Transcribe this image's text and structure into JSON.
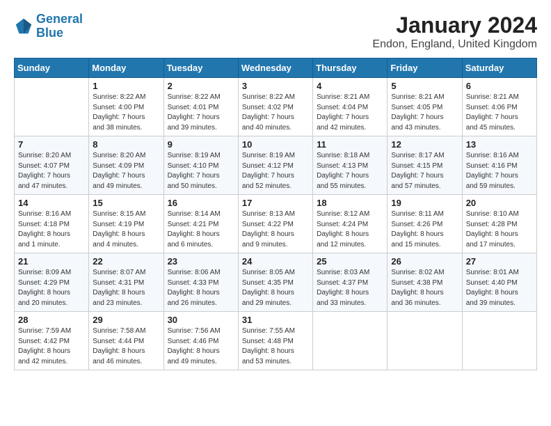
{
  "header": {
    "logo_line1": "General",
    "logo_line2": "Blue",
    "main_title": "January 2024",
    "subtitle": "Endon, England, United Kingdom"
  },
  "days_of_week": [
    "Sunday",
    "Monday",
    "Tuesday",
    "Wednesday",
    "Thursday",
    "Friday",
    "Saturday"
  ],
  "weeks": [
    [
      {
        "day": "",
        "info": ""
      },
      {
        "day": "1",
        "info": "Sunrise: 8:22 AM\nSunset: 4:00 PM\nDaylight: 7 hours\nand 38 minutes."
      },
      {
        "day": "2",
        "info": "Sunrise: 8:22 AM\nSunset: 4:01 PM\nDaylight: 7 hours\nand 39 minutes."
      },
      {
        "day": "3",
        "info": "Sunrise: 8:22 AM\nSunset: 4:02 PM\nDaylight: 7 hours\nand 40 minutes."
      },
      {
        "day": "4",
        "info": "Sunrise: 8:21 AM\nSunset: 4:04 PM\nDaylight: 7 hours\nand 42 minutes."
      },
      {
        "day": "5",
        "info": "Sunrise: 8:21 AM\nSunset: 4:05 PM\nDaylight: 7 hours\nand 43 minutes."
      },
      {
        "day": "6",
        "info": "Sunrise: 8:21 AM\nSunset: 4:06 PM\nDaylight: 7 hours\nand 45 minutes."
      }
    ],
    [
      {
        "day": "7",
        "info": "Sunrise: 8:20 AM\nSunset: 4:07 PM\nDaylight: 7 hours\nand 47 minutes."
      },
      {
        "day": "8",
        "info": "Sunrise: 8:20 AM\nSunset: 4:09 PM\nDaylight: 7 hours\nand 49 minutes."
      },
      {
        "day": "9",
        "info": "Sunrise: 8:19 AM\nSunset: 4:10 PM\nDaylight: 7 hours\nand 50 minutes."
      },
      {
        "day": "10",
        "info": "Sunrise: 8:19 AM\nSunset: 4:12 PM\nDaylight: 7 hours\nand 52 minutes."
      },
      {
        "day": "11",
        "info": "Sunrise: 8:18 AM\nSunset: 4:13 PM\nDaylight: 7 hours\nand 55 minutes."
      },
      {
        "day": "12",
        "info": "Sunrise: 8:17 AM\nSunset: 4:15 PM\nDaylight: 7 hours\nand 57 minutes."
      },
      {
        "day": "13",
        "info": "Sunrise: 8:16 AM\nSunset: 4:16 PM\nDaylight: 7 hours\nand 59 minutes."
      }
    ],
    [
      {
        "day": "14",
        "info": "Sunrise: 8:16 AM\nSunset: 4:18 PM\nDaylight: 8 hours\nand 1 minute."
      },
      {
        "day": "15",
        "info": "Sunrise: 8:15 AM\nSunset: 4:19 PM\nDaylight: 8 hours\nand 4 minutes."
      },
      {
        "day": "16",
        "info": "Sunrise: 8:14 AM\nSunset: 4:21 PM\nDaylight: 8 hours\nand 6 minutes."
      },
      {
        "day": "17",
        "info": "Sunrise: 8:13 AM\nSunset: 4:22 PM\nDaylight: 8 hours\nand 9 minutes."
      },
      {
        "day": "18",
        "info": "Sunrise: 8:12 AM\nSunset: 4:24 PM\nDaylight: 8 hours\nand 12 minutes."
      },
      {
        "day": "19",
        "info": "Sunrise: 8:11 AM\nSunset: 4:26 PM\nDaylight: 8 hours\nand 15 minutes."
      },
      {
        "day": "20",
        "info": "Sunrise: 8:10 AM\nSunset: 4:28 PM\nDaylight: 8 hours\nand 17 minutes."
      }
    ],
    [
      {
        "day": "21",
        "info": "Sunrise: 8:09 AM\nSunset: 4:29 PM\nDaylight: 8 hours\nand 20 minutes."
      },
      {
        "day": "22",
        "info": "Sunrise: 8:07 AM\nSunset: 4:31 PM\nDaylight: 8 hours\nand 23 minutes."
      },
      {
        "day": "23",
        "info": "Sunrise: 8:06 AM\nSunset: 4:33 PM\nDaylight: 8 hours\nand 26 minutes."
      },
      {
        "day": "24",
        "info": "Sunrise: 8:05 AM\nSunset: 4:35 PM\nDaylight: 8 hours\nand 29 minutes."
      },
      {
        "day": "25",
        "info": "Sunrise: 8:03 AM\nSunset: 4:37 PM\nDaylight: 8 hours\nand 33 minutes."
      },
      {
        "day": "26",
        "info": "Sunrise: 8:02 AM\nSunset: 4:38 PM\nDaylight: 8 hours\nand 36 minutes."
      },
      {
        "day": "27",
        "info": "Sunrise: 8:01 AM\nSunset: 4:40 PM\nDaylight: 8 hours\nand 39 minutes."
      }
    ],
    [
      {
        "day": "28",
        "info": "Sunrise: 7:59 AM\nSunset: 4:42 PM\nDaylight: 8 hours\nand 42 minutes."
      },
      {
        "day": "29",
        "info": "Sunrise: 7:58 AM\nSunset: 4:44 PM\nDaylight: 8 hours\nand 46 minutes."
      },
      {
        "day": "30",
        "info": "Sunrise: 7:56 AM\nSunset: 4:46 PM\nDaylight: 8 hours\nand 49 minutes."
      },
      {
        "day": "31",
        "info": "Sunrise: 7:55 AM\nSunset: 4:48 PM\nDaylight: 8 hours\nand 53 minutes."
      },
      {
        "day": "",
        "info": ""
      },
      {
        "day": "",
        "info": ""
      },
      {
        "day": "",
        "info": ""
      }
    ]
  ]
}
